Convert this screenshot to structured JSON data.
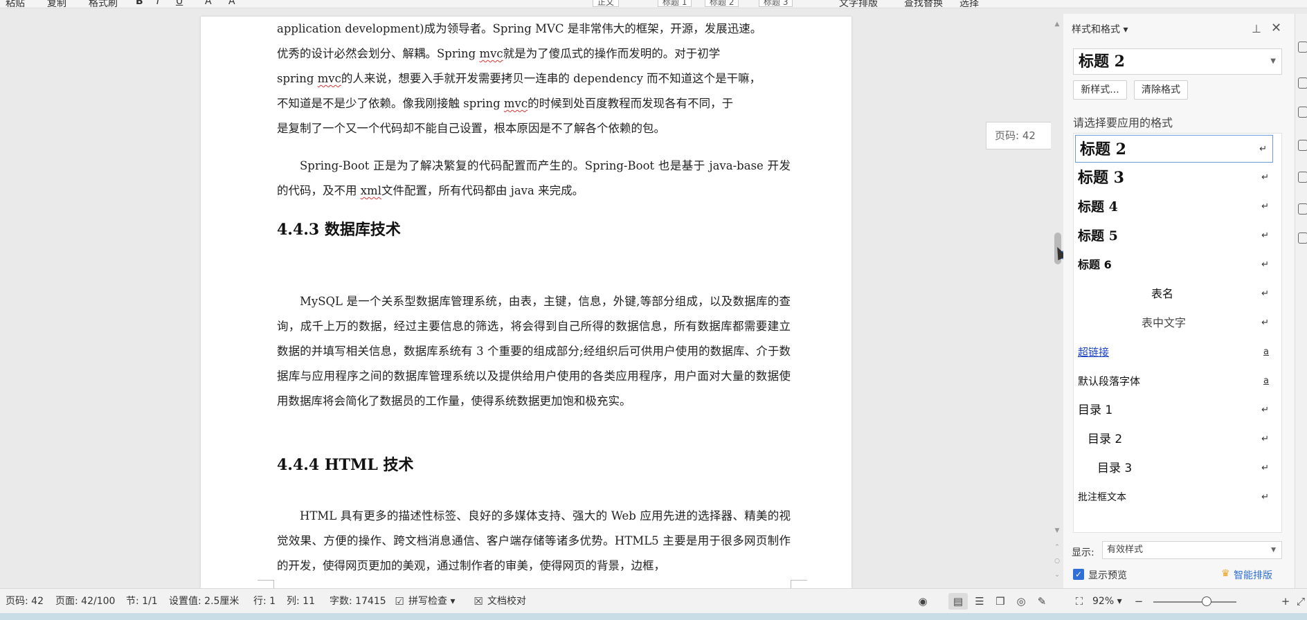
{
  "toolbar": {
    "items": [
      "粘贴",
      "复制",
      "格式刷",
      "B",
      "I",
      "U",
      "A",
      "A",
      "正文",
      "标题 1",
      "标题 2",
      "标题 3",
      "文字排版",
      "查找替换",
      "选择"
    ]
  },
  "document": {
    "para1_line0": "优秀的设计必然会划分、解耦。Spring ",
    "para1_u0": "mvc",
    "para1_line0b": "就是为了傻瓜式的操作而发明的。对于初学",
    "para1_top": "application development)成为领导者。Spring MVC 是非常伟大的框架，开源，发展迅速。",
    "para1_line1a": "spring ",
    "para1_u1": "mvc",
    "para1_line1b": "的人来说，想要入手就开发需要拷贝一连串的 dependency 而不知道这个是干嘛，",
    "para1_line2a": "不知道是不是少了依赖。像我刚接触 spring ",
    "para1_u2": "mvc",
    "para1_line2b": "的时候到处百度教程而发现各有不同，于",
    "para1_line3": "是复制了一个又一个代码却不能自己设置，根本原因是不了解各个依赖的包。",
    "para2_a": "Spring-Boot 正是为了解决繁复的代码配置而产生的。Spring-Boot 也是基于 java-base 开发的代码，及不用 ",
    "para2_u": "xml",
    "para2_b": "文件配置，所有代码都由 java 来完成。",
    "heading_443": "4.4.3 数据库技术",
    "para3": "MySQL 是一个关系型数据库管理系统，由表，主键，信息，外键,等部分组成，以及数据库的查询，成千上万的数据，经过主要信息的筛选，将会得到自己所得的数据信息，所有数据库都需要建立数据的并填写相关信息，数据库系统有 3 个重要的组成部分;经组织后可供用户使用的数据库、介于数据库与应用程序之间的数据库管理系统以及提供给用户使用的各类应用程序，用户面对大量的数据使用数据库将会简化了数据员的工作量，使得系统数据更加饱和极充实。",
    "heading_444": "4.4.4 HTML 技术",
    "para4": "HTML 具有更多的描述性标签、良好的多媒体支持、强大的 Web 应用先进的选择器、精美的视觉效果、方便的操作、跨文档消息通信、客户端存储等诸多优势。HTML5 主要是用于很多网页制作的开发，使得网页更加的美观，通过制作者的审美，使得网页的背景，边框，"
  },
  "page_badge": "页码: 42",
  "panel": {
    "title": "样式和格式",
    "current_style": "标题 2",
    "new_style_btn": "新样式...",
    "clear_format_btn": "清除格式",
    "prompt": "请选择要应用的格式",
    "styles": [
      {
        "label": "标题 2",
        "mark": "↵"
      },
      {
        "label": "标题 3",
        "mark": "↵"
      },
      {
        "label": "标题 4",
        "mark": "↵"
      },
      {
        "label": "标题 5",
        "mark": "↵"
      },
      {
        "label": "标题 6",
        "mark": "↵"
      },
      {
        "label": "表名",
        "mark": "↵"
      },
      {
        "label": "表中文字",
        "mark": "↵"
      },
      {
        "label": "超链接",
        "mark": "a"
      },
      {
        "label": "默认段落字体",
        "mark": "a"
      },
      {
        "label": "目录 1",
        "mark": "↵"
      },
      {
        "label": "目录 2",
        "mark": "↵"
      },
      {
        "label": "目录 3",
        "mark": "↵"
      },
      {
        "label": "批注框文本",
        "mark": "↵"
      }
    ],
    "display_label": "显示:",
    "display_value": "有效样式",
    "preview_label": "显示预览",
    "smart_layout": "智能排版"
  },
  "status": {
    "page_no": "页码: 42",
    "pages": "页面: 42/100",
    "section": "节: 1/1",
    "setting": "设置值: 2.5厘米",
    "row": "行: 1",
    "col": "列: 11",
    "words": "字数: 17415",
    "spellcheck": "拼写检查",
    "doc_check": "文档校对",
    "zoom": "92%"
  },
  "colors": {
    "accent": "#2f6fd6",
    "hyperlink": "#1a44c8",
    "spell_underline": "#dd3333"
  }
}
